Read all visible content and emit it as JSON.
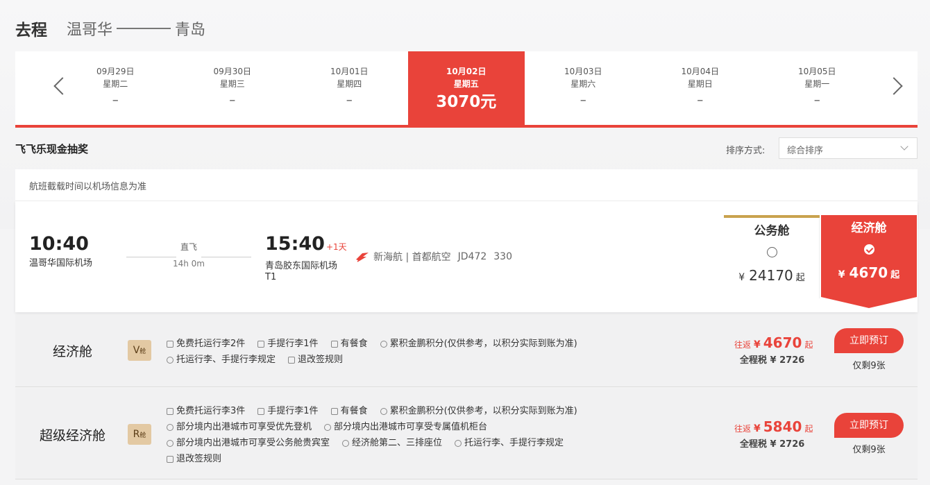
{
  "header": {
    "direction": "去程",
    "from": "温哥华",
    "to": "青岛"
  },
  "dates": [
    {
      "date": "09月29日",
      "weekday": "星期二",
      "price": "–"
    },
    {
      "date": "09月30日",
      "weekday": "星期三",
      "price": "–"
    },
    {
      "date": "10月01日",
      "weekday": "星期四",
      "price": "–"
    },
    {
      "date": "10月02日",
      "weekday": "星期五",
      "price": "3070元"
    },
    {
      "date": "10月03日",
      "weekday": "星期六",
      "price": "–"
    },
    {
      "date": "10月04日",
      "weekday": "星期日",
      "price": "–"
    },
    {
      "date": "10月05日",
      "weekday": "星期一",
      "price": "–"
    }
  ],
  "promo": "飞飞乐现金抽奖",
  "sort": {
    "label": "排序方式:",
    "value": "综合排序"
  },
  "notice": "航班截载时间以机场信息为准",
  "flight": {
    "dep_time": "10:40",
    "dep_airport": "温哥华国际机场",
    "type": "直飞",
    "duration": "14h 0m",
    "arr_time": "15:40",
    "arr_plus": "+1天",
    "arr_airport": "青岛胶东国际机场",
    "arr_terminal": "T1",
    "airline": "新海航 | 首都航空",
    "flight_no": "JD472",
    "aircraft": "330",
    "business": {
      "name": "公务舱",
      "currency": "¥",
      "price": "24170",
      "suffix": "起"
    },
    "economy": {
      "name": "经济舱",
      "currency": "¥",
      "price": "4670",
      "suffix": "起"
    }
  },
  "fares": [
    {
      "name": "经济舱",
      "badge": "V",
      "badge_sub": "舱",
      "features": [
        [
          "免费托运行李2件",
          "手提行李1件",
          "有餐食",
          "累积金鹏积分(仅供参考，以积分实际到账为准)"
        ],
        [
          "托运行李、手提行李规定",
          "退改签规则"
        ]
      ],
      "round_trip": "往返",
      "currency": "¥",
      "price": "4670",
      "suffix": "起",
      "tax": "全程税 ¥ 2726",
      "book": "立即预订",
      "remaining": "仅剩9张"
    },
    {
      "name": "超级经济舱",
      "badge": "R",
      "badge_sub": "舱",
      "features": [
        [
          "免费托运行李3件",
          "手提行李1件",
          "有餐食",
          "累积金鹏积分(仅供参考，以积分实际到账为准)"
        ],
        [
          "部分境内出港城市可享受优先登机",
          "部分境内出港城市可享受专属值机柜台"
        ],
        [
          "部分境内出港城市可享受公务舱贵宾室",
          "经济舱第二、三排座位",
          "托运行李、手提行李规定"
        ],
        [
          "退改签规则"
        ]
      ],
      "round_trip": "往返",
      "currency": "¥",
      "price": "5840",
      "suffix": "起",
      "tax": "全程税 ¥ 2726",
      "book": "立即预订",
      "remaining": "仅剩9张"
    }
  ]
}
